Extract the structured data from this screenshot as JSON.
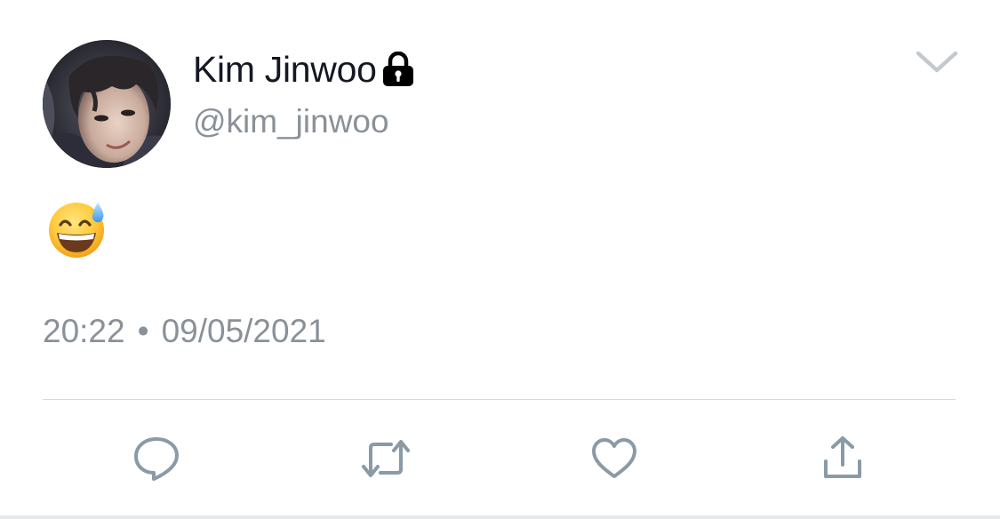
{
  "tweet": {
    "display_name": "Kim Jinwoo",
    "handle": "@kim_jinwoo",
    "body": "😅",
    "time": "20:22",
    "separator": "•",
    "date": "09/05/2021",
    "protected_icon": "lock-icon",
    "menu_icon": "chevron-down-icon"
  },
  "actions": [
    {
      "icon": "reply-icon"
    },
    {
      "icon": "retweet-icon"
    },
    {
      "icon": "like-icon"
    },
    {
      "icon": "share-icon"
    }
  ],
  "colors": {
    "text_primary": "#141823",
    "text_secondary": "#8a9198",
    "action_icon": "#8a9aa6",
    "divider": "#d6d9dc"
  }
}
